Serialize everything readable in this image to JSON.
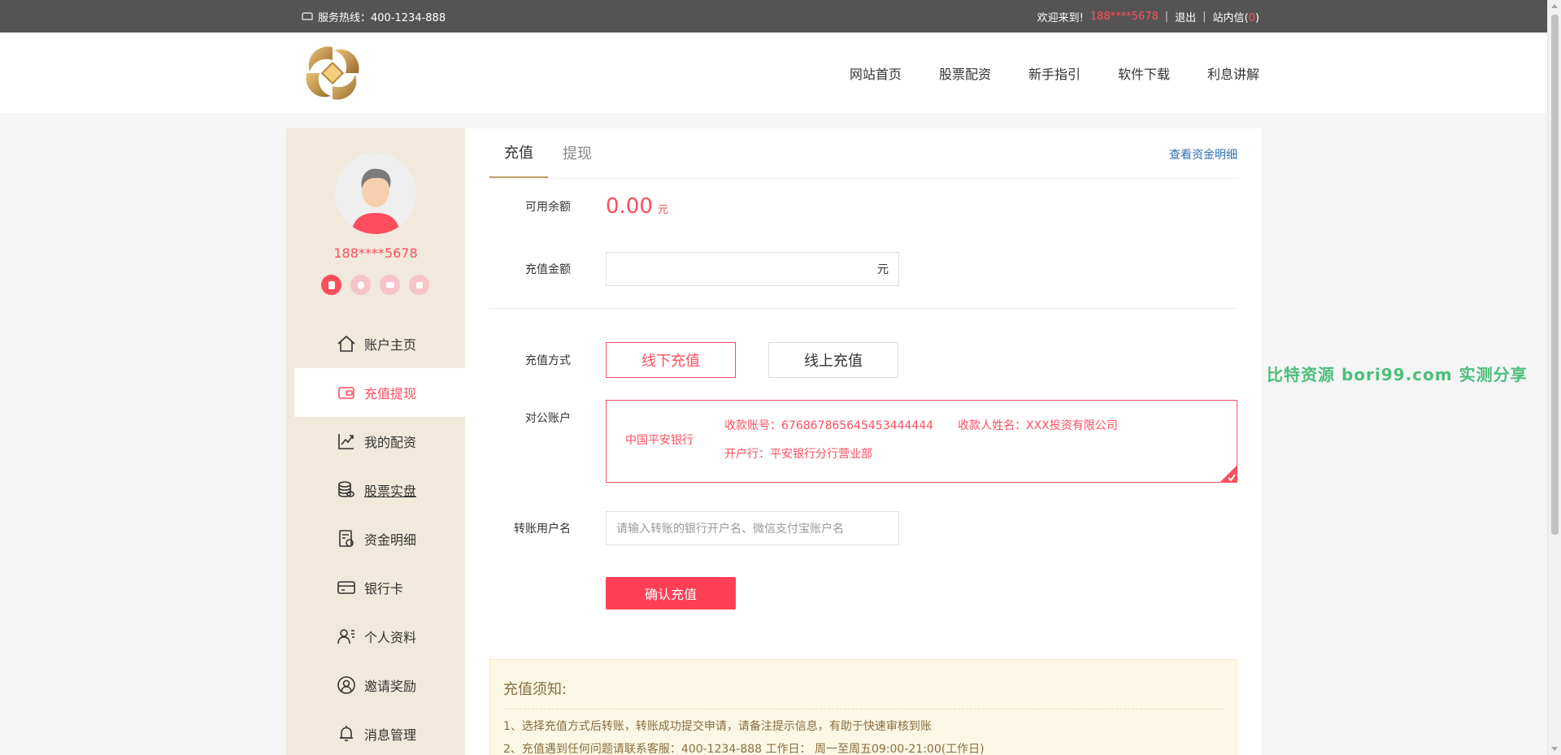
{
  "topbar": {
    "hotline_label": "服务热线：400-1234-888",
    "welcome": "欢迎来到!",
    "user_phone": "188****5678",
    "logout": "退出",
    "messages_label": "站内信",
    "messages_count": "0"
  },
  "nav": {
    "items": [
      {
        "label": "网站首页"
      },
      {
        "label": "股票配资"
      },
      {
        "label": "新手指引"
      },
      {
        "label": "软件下载"
      },
      {
        "label": "利息讲解"
      }
    ]
  },
  "sidebar": {
    "username": "188****5678",
    "menu": [
      {
        "label": "账户主页",
        "icon": "home-icon"
      },
      {
        "label": "充值提现",
        "icon": "wallet-icon"
      },
      {
        "label": "我的配资",
        "icon": "chart-icon"
      },
      {
        "label": "股票实盘",
        "icon": "coins-icon"
      },
      {
        "label": "资金明细",
        "icon": "ledger-icon"
      },
      {
        "label": "银行卡",
        "icon": "card-icon"
      },
      {
        "label": "个人资料",
        "icon": "profile-icon"
      },
      {
        "label": "邀请奖励",
        "icon": "user-circle-icon"
      },
      {
        "label": "消息管理",
        "icon": "bell-icon"
      }
    ]
  },
  "tabs": {
    "recharge": "充值",
    "withdraw": "提现",
    "detail_link": "查看资金明细"
  },
  "form": {
    "balance_label": "可用余额",
    "balance_value": "0.00",
    "balance_unit": "元",
    "amount_label": "充值金额",
    "amount_unit": "元",
    "method_label": "充值方式",
    "method_offline": "线下充值",
    "method_online": "线上充值",
    "corporate_label": "对公账户",
    "bank_name": "中国平安银行",
    "account_no": "收款账号：676867865645453444444",
    "account_holder": "收款人姓名：XXX投资有限公司",
    "branch": "开户行：平安银行分行营业部",
    "transfer_name_label": "转账用户名",
    "transfer_name_placeholder": "请输入转账的银行开户名、微信支付宝账户名",
    "confirm": "确认充值"
  },
  "notice": {
    "title": "充值须知:",
    "items": [
      "1、选择充值方式后转账，转账成功提交申请，请备注提示信息，有助于快速审核到账",
      "2、充值遇到任何问题请联系客服：400-1234-888 工作日： 周一至周五09:00-21:00(工作日)"
    ]
  },
  "watermark": "比特资源 bori99.com 实测分享",
  "colors": {
    "accent": "#ff4d5e",
    "sidebar_bg": "#f0e9dc",
    "topbar_bg": "#545454",
    "link": "#2f6fb5"
  }
}
